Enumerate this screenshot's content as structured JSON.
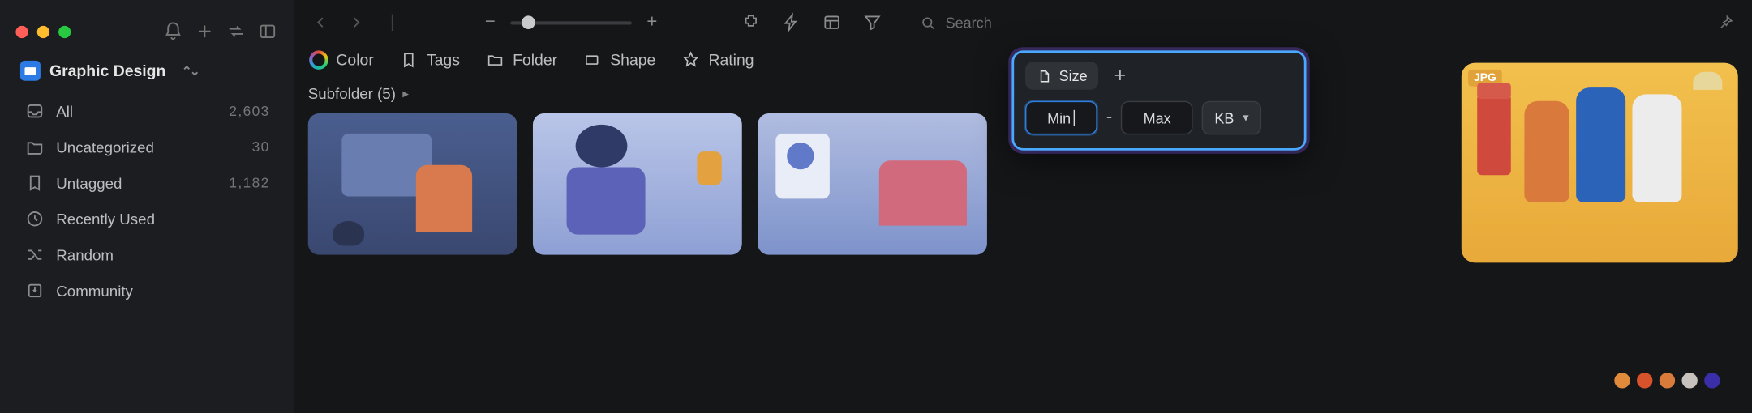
{
  "workspace": {
    "title": "Graphic Design"
  },
  "sidebar": {
    "items": [
      {
        "label": "All",
        "count": "2,603"
      },
      {
        "label": "Uncategorized",
        "count": "30"
      },
      {
        "label": "Untagged",
        "count": "1,182"
      },
      {
        "label": "Recently Used",
        "count": ""
      },
      {
        "label": "Random",
        "count": ""
      },
      {
        "label": "Community",
        "count": ""
      }
    ]
  },
  "toolbar": {
    "search_placeholder": "Search"
  },
  "filters": {
    "color": "Color",
    "tags": "Tags",
    "folder": "Folder",
    "shape": "Shape",
    "rating": "Rating"
  },
  "subfolder": {
    "label": "Subfolder (5)"
  },
  "popover": {
    "tab_label": "Size",
    "min_placeholder": "Min",
    "max_placeholder": "Max",
    "dash": "-",
    "unit": "KB"
  },
  "thumbnail": {
    "badge": "JPG"
  },
  "palette": [
    "#e08a3c",
    "#d8532b",
    "#d97b3a",
    "#c7c2bd",
    "#3a2fa8"
  ]
}
